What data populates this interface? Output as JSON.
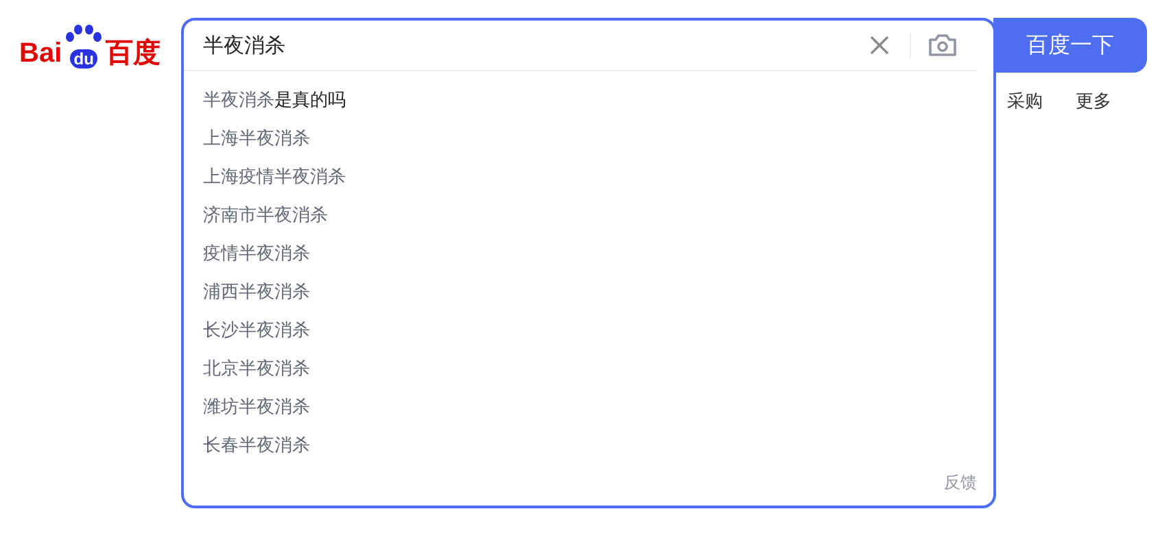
{
  "logo": {
    "text_left": "Bai",
    "paw_text": "du",
    "text_right": "百度"
  },
  "search": {
    "value": "半夜消杀",
    "button": "百度一下"
  },
  "nav_links": [
    "采购",
    "更多"
  ],
  "suggestions": [
    {
      "parts": [
        {
          "text": "半夜消杀",
          "emphasis": false
        },
        {
          "text": "是真的吗",
          "emphasis": true
        }
      ]
    },
    {
      "parts": [
        {
          "text": "上海半夜消杀",
          "emphasis": false
        }
      ]
    },
    {
      "parts": [
        {
          "text": "上海疫情半夜消杀",
          "emphasis": false
        }
      ]
    },
    {
      "parts": [
        {
          "text": "济南市半夜消杀",
          "emphasis": false
        }
      ]
    },
    {
      "parts": [
        {
          "text": "疫情半夜消杀",
          "emphasis": false
        }
      ]
    },
    {
      "parts": [
        {
          "text": "浦西半夜消杀",
          "emphasis": false
        }
      ]
    },
    {
      "parts": [
        {
          "text": "长沙半夜消杀",
          "emphasis": false
        }
      ]
    },
    {
      "parts": [
        {
          "text": "北京半夜消杀",
          "emphasis": false
        }
      ]
    },
    {
      "parts": [
        {
          "text": "潍坊半夜消杀",
          "emphasis": false
        }
      ]
    },
    {
      "parts": [
        {
          "text": "长春半夜消杀",
          "emphasis": false
        }
      ]
    }
  ],
  "feedback": "反馈"
}
